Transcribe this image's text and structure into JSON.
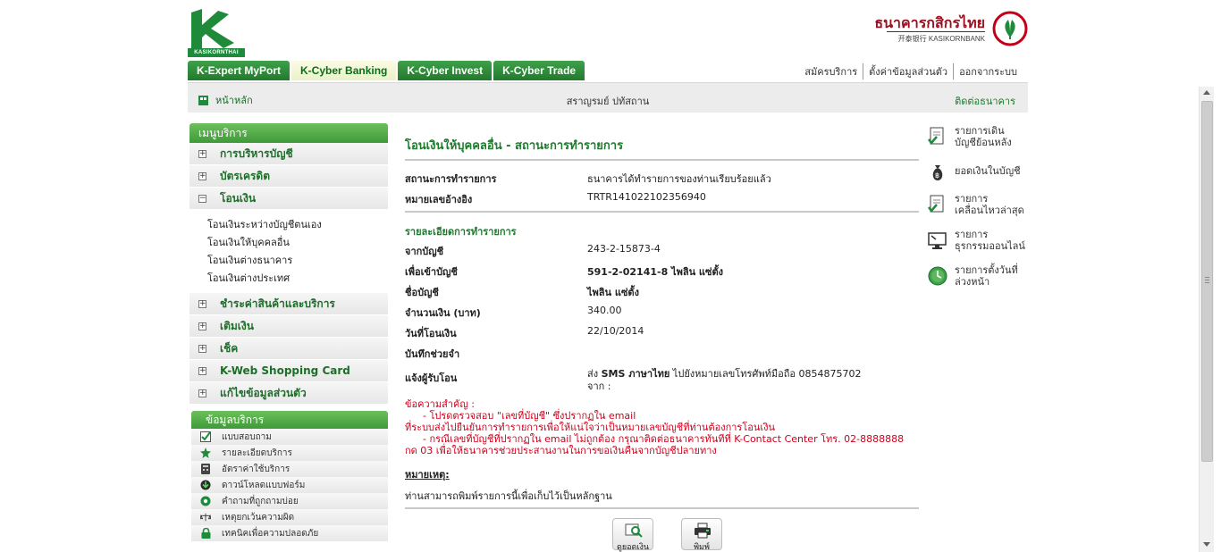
{
  "header": {
    "left_logo_caption": "KASIKORNTHAI",
    "right_logo_thai": "ธนาคารกสิกรไทย",
    "right_logo_english": "开泰银行 KASIKORNBANK",
    "tabs": [
      {
        "label": "K-Expert MyPort",
        "active": false
      },
      {
        "label": "K-Cyber Banking",
        "active": true
      },
      {
        "label": "K-Cyber Invest",
        "active": false
      },
      {
        "label": "K-Cyber Trade",
        "active": false
      }
    ],
    "links": [
      "สมัครบริการ",
      "ตั้งค่าข้อมูลส่วนตัว",
      "ออกจากระบบ"
    ]
  },
  "navbar": {
    "home_label": "หน้าหลัก",
    "user_name": "สราญรมย์ ปทัสถาน",
    "contact_label": "ติดต่อธนาคาร"
  },
  "menu": {
    "title": "เมนูบริการ",
    "items": [
      {
        "label": "การบริหารบัญชี",
        "expanded": false
      },
      {
        "label": "บัตรเครดิต",
        "expanded": false
      },
      {
        "label": "โอนเงิน",
        "expanded": true
      },
      {
        "label": "ชำระค่าสินค้าและบริการ",
        "expanded": false
      },
      {
        "label": "เติมเงิน",
        "expanded": false
      },
      {
        "label": "เช็ค",
        "expanded": false
      },
      {
        "label": "K-Web Shopping Card",
        "expanded": false
      },
      {
        "label": "แก้ไขข้อมูลส่วนตัว",
        "expanded": false
      }
    ],
    "transfer_submenu": [
      "โอนเงินระหว่างบัญชีตนเอง",
      "โอนเงินให้บุคคลอื่น",
      "โอนเงินต่างธนาคาร",
      "โอนเงินต่างประเทศ"
    ]
  },
  "info": {
    "title": "ข้อมูลบริการ",
    "items": [
      {
        "label": "แบบสอบถาม",
        "icon": "checkmark-icon"
      },
      {
        "label": "รายละเอียดบริการ",
        "icon": "star-icon"
      },
      {
        "label": "อัตราค่าใช้บริการ",
        "icon": "calculator-icon"
      },
      {
        "label": "ดาวน์โหลดแบบฟอร์ม",
        "icon": "download-icon"
      },
      {
        "label": "คำถามที่ถูกถามบ่อย",
        "icon": "question-icon"
      },
      {
        "label": "เหตุยกเว้นความผิด",
        "icon": "scale-icon"
      },
      {
        "label": "เทคนิคเพื่อความปลอดภัย",
        "icon": "lock-icon"
      }
    ]
  },
  "main": {
    "title": "โอนเงินให้บุคคลอื่น - สถานะการทำรายการ",
    "status_label": "สถานะการทำรายการ",
    "status_value": "ธนาคารได้ทำรายการของท่านเรียบร้อยแล้ว",
    "ref_label": "หมายเลขอ้างอิง",
    "ref_value": "TRTR141022102356940",
    "details_title": "รายละเอียดการทำรายการ",
    "from_label": "จากบัญชี",
    "from_value": "243-2-15873-4",
    "to_label": "เพื่อเข้าบัญชี",
    "to_value": "591-2-02141-8 ไพลิน แซ่ตั้ง",
    "name_label": "ชื่อบัญชี",
    "name_value": "ไพลิน แซ่ตั้ง",
    "amount_label": "จำนวนเงิน (บาท)",
    "amount_value": "340.00",
    "date_label": "วันที่โอนเงิน",
    "date_value": "22/10/2014",
    "memo_label": "บันทึกช่วยจำ",
    "memo_value": "",
    "notify_label": "แจ้งผู้รับโอน",
    "notify_prefix": "ส่ง ",
    "notify_bold": "SMS ภาษาไทย",
    "notify_suffix": " ไปยังหมายเลขโทรศัพท์มือถือ 0854875702",
    "notify_from": "จาก :",
    "notice_title": "ข้อความสำคัญ :",
    "notice_line1": "- โปรดตรวจสอบ \"เลขที่บัญชี\" ซึ่งปรากฏใน email",
    "notice_line2": "ที่ระบบส่งไปยืนยันการทำรายการเพื่อให้แน่ใจว่าเป็นหมายเลขบัญชีที่ท่านต้องการโอนเงิน",
    "notice_line3": "- กรณีเลขที่บัญชีที่ปรากฏใน email ไม่ถูกต้อง กรุณาติดต่อธนาคารทันทีที่ K-Contact Center โทร. 02-8888888",
    "notice_line4": "กด 03 เพื่อให้ธนาคารช่วยประสานงานในการขอเงินคืนจากบัญชีปลายทาง",
    "remark_label": "หมายเหตุ:",
    "remark_text": "ท่านสามารถพิมพ์รายการนี้เพื่อเก็บไว้เป็นหลักฐาน",
    "buttons": [
      "ดูยอดเงิน",
      "พิมพ์"
    ]
  },
  "quick_links": [
    {
      "line1": "รายการเดิน",
      "line2": "บัญชีย้อนหลัง",
      "icon": "statement-icon"
    },
    {
      "line1": "ยอดเงินในบัญชี",
      "line2": "",
      "icon": "money-bag-icon"
    },
    {
      "line1": "รายการ",
      "line2": "เคลื่อนไหวล่าสุด",
      "icon": "recent-transactions-icon"
    },
    {
      "line1": "รายการ",
      "line2": "ธุรกรรมออนไลน์",
      "icon": "online-transactions-icon"
    },
    {
      "line1": "รายการตั้งวันที่",
      "line2": "ล่วงหน้า",
      "icon": "clock-icon"
    }
  ],
  "colors": {
    "brand_green": "#1f7a2e",
    "tab_green": "#227a2d",
    "notice_red": "#d0001b",
    "bank_red": "#9a1020"
  }
}
